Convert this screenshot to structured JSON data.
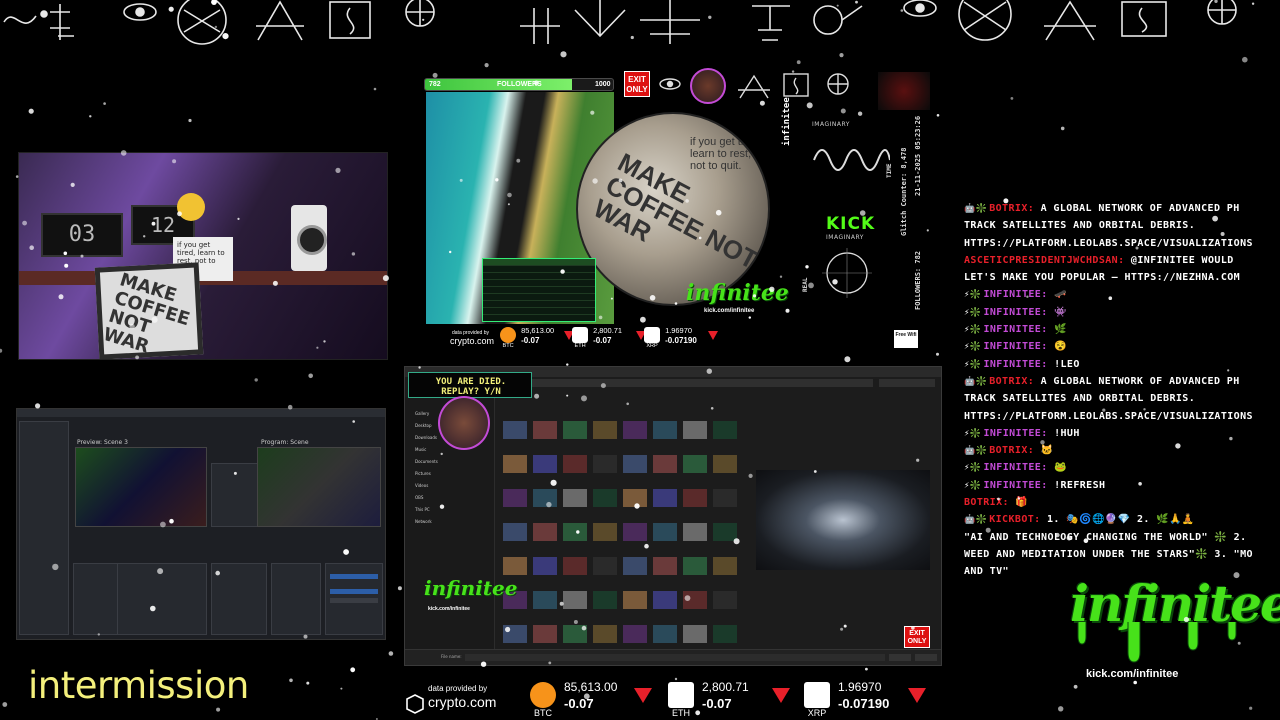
{
  "stream": {
    "followers_label": "FOLLOWERS",
    "followers_current": "782",
    "followers_goal": "1000",
    "followers_progress": 0.782,
    "exit_badge": "EXIT ONLY",
    "exit_badge_line1": "EXIT",
    "exit_badge_line2": "ONLY",
    "kick_label": "KICK",
    "imaginary_top": "IMAGINARY",
    "imaginary_mid": "IMAGINARY",
    "time_label": "TIME",
    "real_label": "REAL",
    "glitch_counter": "Glitch Counter: 8,478",
    "date_time": "21-11-2025 05:23:26",
    "followers_vertical": "FOLLOWERS: 782",
    "vertical_name": "infinitee",
    "webcam_clock": "03",
    "webcam_clock2": "12",
    "frame_text": "MAKE COFFEE NOT WAR",
    "quote_text": "if you get tired, learn to rest, not to quit.",
    "free_badge": "Free Wifi",
    "intermission": "intermission",
    "died_line1": "YOU ARE DIED.",
    "died_line2": "REPLAY? Y/N"
  },
  "ticker": {
    "provided_by": "data provided by",
    "provider": "crypto.com",
    "items": [
      {
        "symbol": "BTC",
        "price": "85,613.00",
        "change": "-0.07",
        "color": "#f7931a"
      },
      {
        "symbol": "ETH",
        "price": "2,800.71",
        "change": "-0.07",
        "color": "#ffffff"
      },
      {
        "symbol": "XRP",
        "price": "1.96970",
        "change": "-0.07190",
        "color": "#ffffff"
      }
    ],
    "down_color": "#e8202a"
  },
  "logo": {
    "name": "infinitee",
    "url": "kick.com/infinitee"
  },
  "chat": {
    "accent_user": "#c34bd6",
    "lines": [
      {
        "badges": "🤖❇️",
        "user": "BOTRIX:",
        "text": " A GLOBAL NETWORK OF ADVANCED PH",
        "ucolor": "#e8202a"
      },
      {
        "badges": "",
        "user": "",
        "text": "TRACK SATELLITES AND ORBITAL DEBRIS.",
        "ucolor": "#fff"
      },
      {
        "badges": "",
        "user": "",
        "text": "HTTPS://PLATFORM.LEOLABS.SPACE/VISUALIZATIONS",
        "ucolor": "#fff"
      },
      {
        "badges": "",
        "user": "ASCETICPRESIDENTJWCHDSAN:",
        "text": " @INFINITEE WOULD",
        "ucolor": "#e8202a"
      },
      {
        "badges": "",
        "user": "",
        "text": "LET'S MAKE YOU POPULAR – HTTPS://NEZHNA.COM",
        "ucolor": "#fff"
      },
      {
        "badges": "⚡❇️",
        "user": "INFINITEE:",
        "text": " 🛹",
        "ucolor": "#c34bd6"
      },
      {
        "badges": "⚡❇️",
        "user": "INFINITEE:",
        "text": " 👾",
        "ucolor": "#c34bd6"
      },
      {
        "badges": "⚡❇️",
        "user": "INFINITEE:",
        "text": " 🌿",
        "ucolor": "#c34bd6"
      },
      {
        "badges": "⚡❇️",
        "user": "INFINITEE:",
        "text": " 😵",
        "ucolor": "#c34bd6"
      },
      {
        "badges": "⚡❇️",
        "user": "INFINITEE:",
        "text": " !LEO",
        "ucolor": "#c34bd6"
      },
      {
        "badges": "🤖❇️",
        "user": "BOTRIX:",
        "text": " A GLOBAL NETWORK OF ADVANCED PH",
        "ucolor": "#e8202a"
      },
      {
        "badges": "",
        "user": "",
        "text": "TRACK SATELLITES AND ORBITAL DEBRIS.",
        "ucolor": "#fff"
      },
      {
        "badges": "",
        "user": "",
        "text": "HTTPS://PLATFORM.LEOLABS.SPACE/VISUALIZATIONS",
        "ucolor": "#fff"
      },
      {
        "badges": "⚡❇️",
        "user": "INFINITEE:",
        "text": " !HUH",
        "ucolor": "#c34bd6"
      },
      {
        "badges": "🤖❇️",
        "user": "BOTRIX:",
        "text": " 🐱",
        "ucolor": "#e8202a"
      },
      {
        "badges": "⚡❇️",
        "user": "INFINITEE:",
        "text": " 🐸",
        "ucolor": "#c34bd6"
      },
      {
        "badges": "⚡❇️",
        "user": "INFINITEE:",
        "text": " !REFRESH",
        "ucolor": "#c34bd6"
      },
      {
        "badges": "",
        "user": "BOTRIX:",
        "text": " 🎁",
        "ucolor": "#e8202a"
      },
      {
        "badges": "🤖❇️",
        "user": "KICKBOT:",
        "text": " 1. 🎭🌀🌐🔮💎 2. 🌿🙏🧘",
        "ucolor": "#e8202a"
      },
      {
        "badges": "",
        "user": "",
        "text": "\"AI AND TECHNOLOGY CHANGING THE WORLD\" ❇️ 2.",
        "ucolor": "#fff"
      },
      {
        "badges": "",
        "user": "",
        "text": "WEED AND MEDITATION UNDER THE STARS\"❇️ 3. \"MO",
        "ucolor": "#fff"
      },
      {
        "badges": "",
        "user": "",
        "text": "AND TV\"",
        "ucolor": "#fff"
      }
    ]
  },
  "explorer": {
    "sidebar": [
      "Gallery",
      "Desktop",
      "Downloads",
      "Music",
      "Documents",
      "Pictures",
      "Videos",
      "OBS",
      "This PC",
      "Network"
    ],
    "filename_label": "File name:"
  },
  "obs": {
    "preview_label": "Preview: Scene 3",
    "program_label": "Program: Scene"
  }
}
